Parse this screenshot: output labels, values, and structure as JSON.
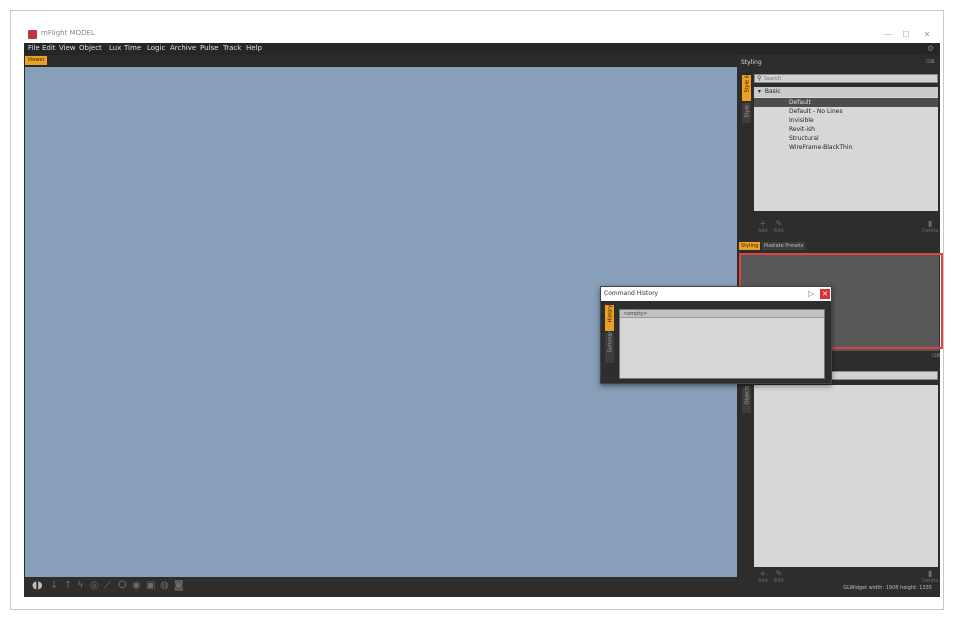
{
  "window": {
    "title": "mFlight MODEL",
    "controls": [
      "—",
      "☐",
      "✕"
    ]
  },
  "menu": {
    "items": [
      "File",
      "Edit",
      "View",
      "Object",
      "Lux",
      "Time",
      "Logic",
      "Archive",
      "Pulse",
      "Track",
      "Help"
    ],
    "settings_icon": "gear-icon"
  },
  "viewer": {
    "tab_label": "Viewer",
    "background_color": "#879fb9"
  },
  "toolbar": {
    "tools": [
      "◖◗",
      "↓",
      "↑",
      "ϟ",
      "◎",
      "⟋",
      "ⵔ",
      "◉",
      "▣",
      "◍",
      "◙"
    ]
  },
  "styling_panel": {
    "title": "Styling",
    "controls": "⊡⊠",
    "vertical_tabs": [
      "Style lib",
      "Style"
    ],
    "search_placeholder": "Search",
    "group": "Basic",
    "items": [
      "Default",
      "Default - No Lines",
      "Invisible",
      "Revit-ish",
      "Structural",
      "WireFrame-BlackThin"
    ],
    "selected_item": "Default",
    "actions": [
      {
        "icon": "+",
        "label": "Add"
      },
      {
        "icon": "✎",
        "label": "Edit"
      },
      {
        "icon": "▮",
        "label": "Delete"
      }
    ],
    "bottom_tabs": [
      "Styling",
      "Pixelate Presets"
    ]
  },
  "objects_panel": {
    "controls": "⊡⊠",
    "vertical_tabs": [
      "Objects"
    ],
    "actions": [
      {
        "icon": "+",
        "label": "Add"
      },
      {
        "icon": "✎",
        "label": "Edit"
      },
      {
        "icon": "▮",
        "label": "Delete"
      }
    ]
  },
  "command_history": {
    "title": "Command History",
    "close_icon": "✕",
    "vertical_tabs": [
      "History",
      "Summary"
    ],
    "row": "<empty>"
  },
  "status": {
    "text": "GLWidget width: 1908 height: 1335"
  },
  "highlight_color": "#e04040"
}
